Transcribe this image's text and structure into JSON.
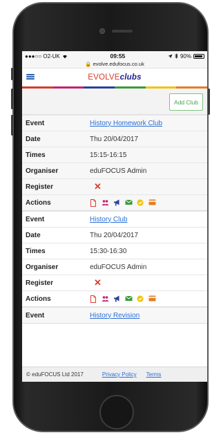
{
  "status_bar": {
    "carrier": "●●●○○ O2-UK",
    "time": "09:55",
    "battery": "90%"
  },
  "url": "evolve.edufocus.co.uk",
  "brand": {
    "part1": "EVOLVE",
    "part2": "clubs"
  },
  "stripe_colors": [
    "#d63c2b",
    "#c4226e",
    "#2a3f9e",
    "#3a9a3a",
    "#f1c40f",
    "#e67e22"
  ],
  "toolbar": {
    "add_club_label": "Add Club"
  },
  "labels": {
    "event": "Event",
    "date": "Date",
    "times": "Times",
    "organiser": "Organiser",
    "register": "Register",
    "actions": "Actions"
  },
  "clubs": [
    {
      "event": "History Homework Club",
      "date": "Thu 20/04/2017",
      "times": "15:15-16:15",
      "organiser": "eduFOCUS Admin",
      "register": "✕"
    },
    {
      "event": "History Club",
      "date": "Thu 20/04/2017",
      "times": "15:30-16:30",
      "organiser": "eduFOCUS Admin",
      "register": "✕"
    },
    {
      "event": "History Revision"
    }
  ],
  "action_icons": [
    "document-icon",
    "group-icon",
    "megaphone-icon",
    "email-icon",
    "check-circle-icon",
    "card-icon"
  ],
  "footer": {
    "copyright": "© eduFOCUS Ltd 2017",
    "privacy": "Privacy Policy",
    "terms": "Terms"
  }
}
